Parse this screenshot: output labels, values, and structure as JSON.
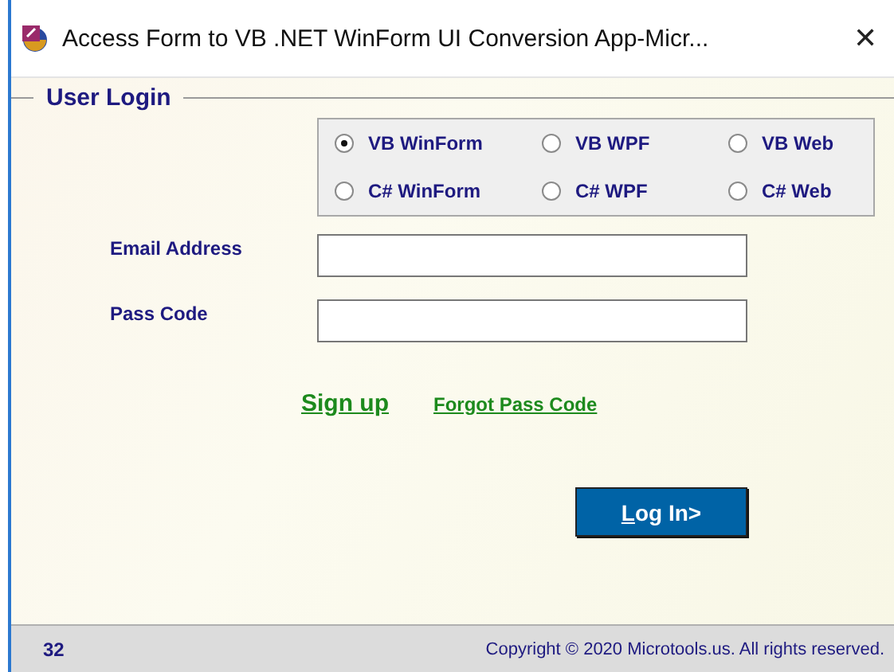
{
  "window": {
    "title": "Access Form to VB .NET WinForm UI Conversion App-Micr...",
    "close": "✕"
  },
  "group": {
    "legend": "User Login"
  },
  "options": [
    {
      "label": "VB WinForm",
      "selected": true
    },
    {
      "label": "VB WPF",
      "selected": false
    },
    {
      "label": "VB Web",
      "selected": false
    },
    {
      "label": "C# WinForm",
      "selected": false
    },
    {
      "label": "C# WPF",
      "selected": false
    },
    {
      "label": "C# Web",
      "selected": false
    }
  ],
  "fields": [
    {
      "label": "Email Address"
    },
    {
      "label": "Pass Code"
    }
  ],
  "links": [
    {
      "label": "Sign up",
      "kind": "large"
    },
    {
      "label": "Forgot Pass Code",
      "kind": "small"
    }
  ],
  "login_button": "Log In>",
  "status_bar": {
    "count": "32",
    "copyright": "Copyright © 2020 Microtools.us. All rights reserved."
  }
}
